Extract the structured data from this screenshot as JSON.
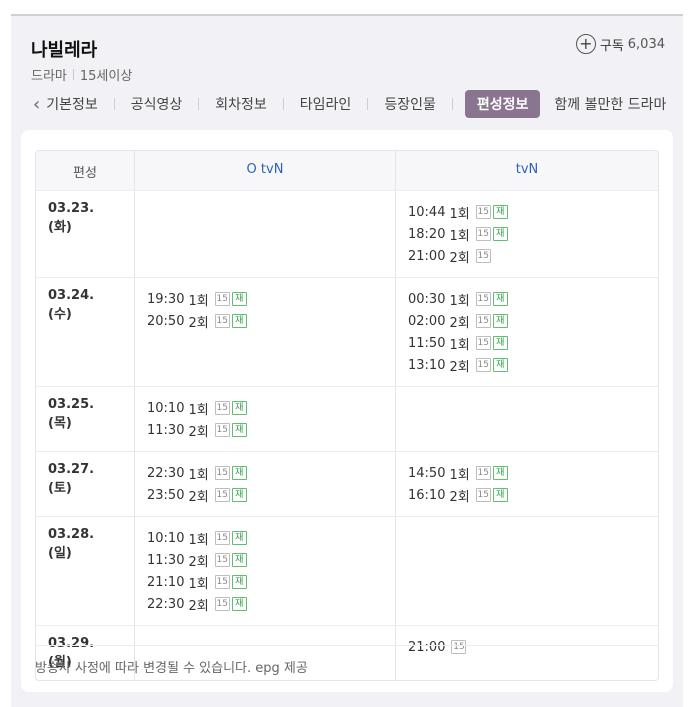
{
  "program": {
    "title": "나빌레라",
    "genre": "드라마",
    "rating": "15세이상",
    "subscribe_label": "구독",
    "subscribe_count": "6,034"
  },
  "tabs": [
    {
      "label": "기본정보",
      "active": false
    },
    {
      "label": "공식영상",
      "active": false
    },
    {
      "label": "회차정보",
      "active": false
    },
    {
      "label": "타임라인",
      "active": false
    },
    {
      "label": "등장인물",
      "active": false
    },
    {
      "label": "편성정보",
      "active": true
    },
    {
      "label": "함께 볼만한 드라마",
      "active": false
    }
  ],
  "schedule": {
    "header": {
      "col1": "편성",
      "col2": "O tvN",
      "col3": "tvN"
    },
    "rows": [
      {
        "date": "03.23. (화)",
        "otvn": [],
        "tvn": [
          {
            "time": "10:44",
            "ep": "1회",
            "rating": "15",
            "rerun": "재"
          },
          {
            "time": "18:20",
            "ep": "1회",
            "rating": "15",
            "rerun": "재"
          },
          {
            "time": "21:00",
            "ep": "2회",
            "rating": "15",
            "rerun": ""
          }
        ]
      },
      {
        "date": "03.24. (수)",
        "otvn": [
          {
            "time": "19:30",
            "ep": "1회",
            "rating": "15",
            "rerun": "재"
          },
          {
            "time": "20:50",
            "ep": "2회",
            "rating": "15",
            "rerun": "재"
          }
        ],
        "tvn": [
          {
            "time": "00:30",
            "ep": "1회",
            "rating": "15",
            "rerun": "재"
          },
          {
            "time": "02:00",
            "ep": "2회",
            "rating": "15",
            "rerun": "재"
          },
          {
            "time": "11:50",
            "ep": "1회",
            "rating": "15",
            "rerun": "재"
          },
          {
            "time": "13:10",
            "ep": "2회",
            "rating": "15",
            "rerun": "재"
          }
        ]
      },
      {
        "date": "03.25. (목)",
        "otvn": [
          {
            "time": "10:10",
            "ep": "1회",
            "rating": "15",
            "rerun": "재"
          },
          {
            "time": "11:30",
            "ep": "2회",
            "rating": "15",
            "rerun": "재"
          }
        ],
        "tvn": []
      },
      {
        "date": "03.27. (토)",
        "otvn": [
          {
            "time": "22:30",
            "ep": "1회",
            "rating": "15",
            "rerun": "재"
          },
          {
            "time": "23:50",
            "ep": "2회",
            "rating": "15",
            "rerun": "재"
          }
        ],
        "tvn": [
          {
            "time": "14:50",
            "ep": "1회",
            "rating": "15",
            "rerun": "재"
          },
          {
            "time": "16:10",
            "ep": "2회",
            "rating": "15",
            "rerun": "재"
          }
        ]
      },
      {
        "date": "03.28. (일)",
        "otvn": [
          {
            "time": "10:10",
            "ep": "1회",
            "rating": "15",
            "rerun": "재"
          },
          {
            "time": "11:30",
            "ep": "2회",
            "rating": "15",
            "rerun": "재"
          },
          {
            "time": "21:10",
            "ep": "1회",
            "rating": "15",
            "rerun": "재"
          },
          {
            "time": "22:30",
            "ep": "2회",
            "rating": "15",
            "rerun": "재"
          }
        ],
        "tvn": []
      },
      {
        "date": "03.29. (월)",
        "otvn": [],
        "tvn": [
          {
            "time": "21:00",
            "ep": "",
            "rating": "15",
            "rerun": ""
          }
        ]
      }
    ]
  },
  "footnote": "방송사 사정에 따라 변경될 수 있습니다. epg 제공",
  "colors": {
    "active_tab": "#8a7590",
    "channel_header": "#2e62b5",
    "rerun_badge": "#2fa244"
  }
}
